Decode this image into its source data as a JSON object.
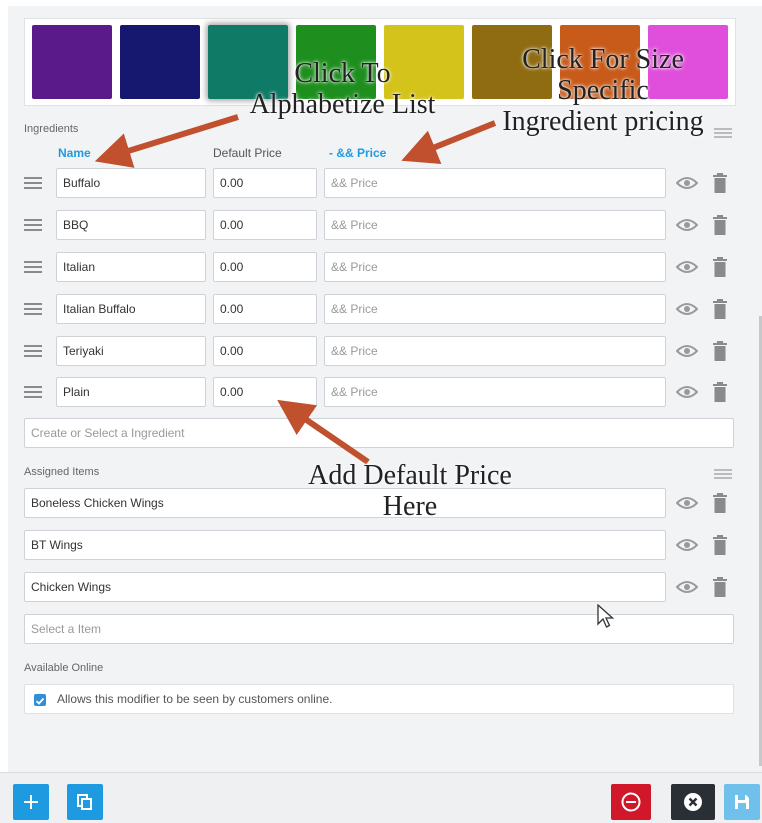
{
  "swatches": [
    {
      "color": "#5a1a8a"
    },
    {
      "color": "#15186e"
    },
    {
      "color": "#0f7a66"
    },
    {
      "color": "#1e8f1e"
    },
    {
      "color": "#d4c31a"
    },
    {
      "color": "#8f6c12"
    },
    {
      "color": "#c85a1a"
    },
    {
      "color": "#e04fdc"
    }
  ],
  "ingredients": {
    "section_label": "Ingredients",
    "col_name": "Name",
    "col_default_price": "Default Price",
    "col_size_price": "- && Price",
    "rows": [
      {
        "name": "Buffalo",
        "price": "0.00",
        "size_price_placeholder": "&& Price"
      },
      {
        "name": "BBQ",
        "price": "0.00",
        "size_price_placeholder": "&& Price"
      },
      {
        "name": "Italian",
        "price": "0.00",
        "size_price_placeholder": "&& Price"
      },
      {
        "name": "Italian Buffalo",
        "price": "0.00",
        "size_price_placeholder": "&& Price"
      },
      {
        "name": "Teriyaki",
        "price": "0.00",
        "size_price_placeholder": "&& Price"
      },
      {
        "name": "Plain",
        "price": "0.00",
        "size_price_placeholder": "&& Price"
      }
    ],
    "create_placeholder": "Create or Select a Ingredient"
  },
  "assigned": {
    "section_label": "Assigned Items",
    "items": [
      "Boneless Chicken Wings",
      "BT Wings",
      "Chicken Wings"
    ],
    "select_placeholder": "Select a Item"
  },
  "online": {
    "section_label": "Available Online",
    "checkbox_label": "Allows this modifier to be seen by customers online.",
    "checked": true
  },
  "annotations": {
    "alphabetize_1": "Click To",
    "alphabetize_2": "Alphabetize List",
    "size_1": "Click For Size",
    "size_2": "Specific",
    "size_3": "Ingredient pricing",
    "default_1": "Add Default Price",
    "default_2": "Here"
  },
  "colors": {
    "accent": "#1e9be0",
    "annotation_arrow": "#c0502e",
    "add_button": "#1e9be0",
    "remove_button": "#d0182a",
    "close_button": "#2a2f36",
    "save_button": "#6fc0ea"
  }
}
